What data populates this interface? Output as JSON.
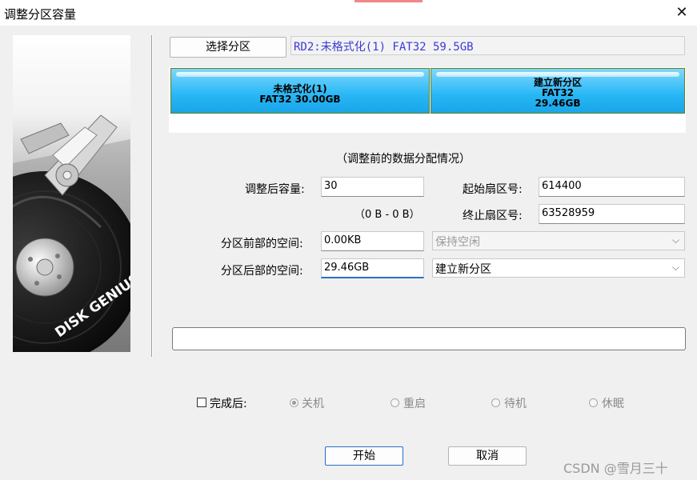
{
  "window": {
    "title": "调整分区容量",
    "close_glyph": "✕"
  },
  "sidebar": {
    "brand_text": "DISK GENIUS"
  },
  "toolbar": {
    "select_partition_label": "选择分区",
    "partition_path": "RD2:未格式化(1) FAT32 59.5GB"
  },
  "partition_map": {
    "segments": [
      {
        "name": "未格式化(1)",
        "fs": "FAT32 30.00GB",
        "size": ""
      },
      {
        "name": "建立新分区",
        "fs": "FAT32",
        "size": "29.46GB"
      }
    ]
  },
  "form": {
    "caption": "（调整前的数据分配情况）",
    "resize_label": "调整后容量:",
    "resize_value": "30",
    "range_hint": "（0 B - 0 B）",
    "start_sector_label": "起始扇区号:",
    "start_sector_value": "614400",
    "end_sector_label": "终止扇区号:",
    "end_sector_value": "63528959",
    "before_space_label": "分区前部的空间:",
    "before_space_value": "0.00KB",
    "before_action": "保持空闲",
    "after_space_label": "分区后部的空间:",
    "after_space_value": "29.46GB",
    "after_action": "建立新分区"
  },
  "completion": {
    "checkbox_label": "完成后:",
    "options": [
      "关机",
      "重启",
      "待机",
      "休眠"
    ]
  },
  "buttons": {
    "start_label": "开始",
    "cancel_label": "取消"
  },
  "watermark": "CSDN @雪月三十"
}
